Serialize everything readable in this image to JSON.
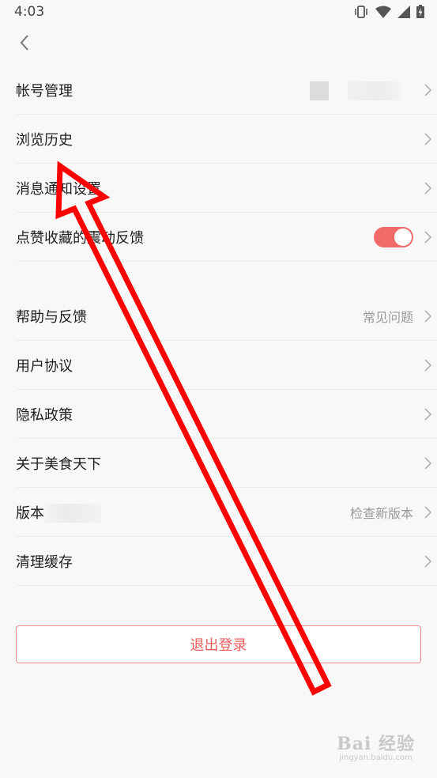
{
  "status_bar": {
    "time": "4:03",
    "icons": [
      "vibrate-icon",
      "wifi-icon",
      "signal-icon",
      "battery-charging-icon"
    ]
  },
  "nav": {
    "back_icon": "chevron-left-icon"
  },
  "section1": {
    "items": [
      {
        "label": "帐号管理"
      },
      {
        "label": "浏览历史"
      },
      {
        "label": "消息通知设置"
      },
      {
        "label": "点赞收藏的震动反馈",
        "toggle_on": true
      }
    ]
  },
  "section2": {
    "items": [
      {
        "label": "帮助与反馈",
        "value": "常见问题"
      },
      {
        "label": "用户协议"
      },
      {
        "label": "隐私政策"
      },
      {
        "label": "关于美食天下"
      },
      {
        "label": "版本",
        "value": "检查新版本"
      },
      {
        "label": "清理缓存"
      }
    ]
  },
  "logout": {
    "label": "退出登录"
  },
  "colors": {
    "accent": "#ef5b5b",
    "toggle": "#f26b6b",
    "annotation_arrow": "#ff0000"
  },
  "watermark": {
    "main": "Bai 经验",
    "sub": "jingyan.baidu.com"
  }
}
